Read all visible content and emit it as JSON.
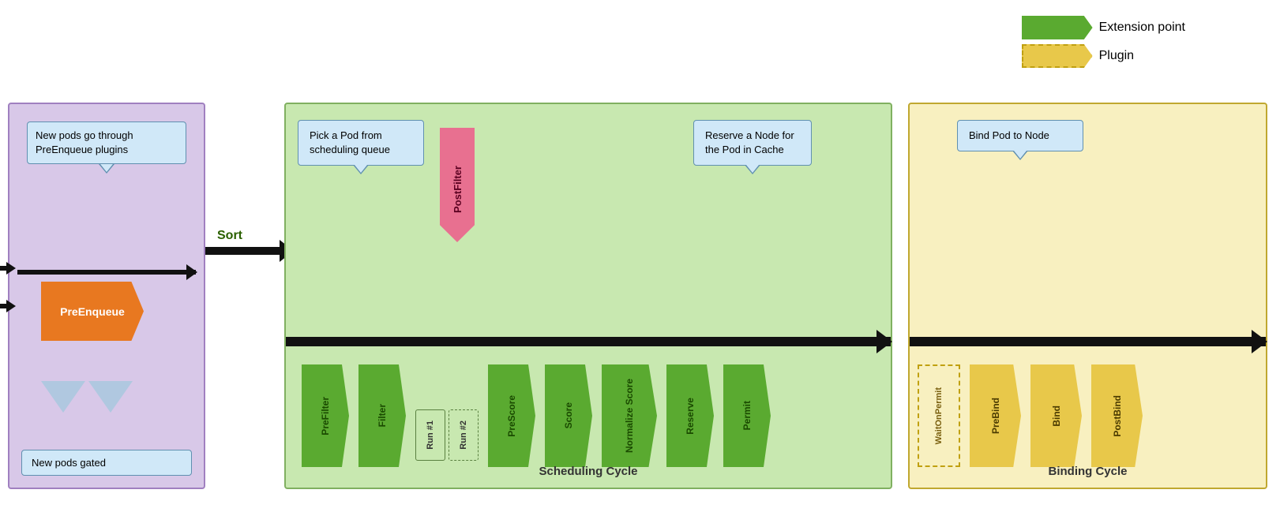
{
  "legend": {
    "extension_point_label": "Extension point",
    "plugin_label": "Plugin"
  },
  "left_panel": {
    "callout_text": "New pods go through PreEnqueue plugins",
    "preenqueue_label": "PreEnqueue",
    "new_pods_gated_label": "New pods gated"
  },
  "sort_label": "Sort",
  "scheduling_panel": {
    "pick_pod_callout": "Pick a Pod from scheduling queue",
    "reserve_callout": "Reserve a Node for the Pod in Cache",
    "postfilter_label": "PostFilter",
    "stages": [
      "PreFilter",
      "Filter",
      "PreScore",
      "Score",
      "Normalize Score",
      "Reserve",
      "Permit"
    ],
    "run1_label": "Run #1",
    "run2_label": "Run #2",
    "cycle_label": "Scheduling Cycle"
  },
  "binding_panel": {
    "bind_callout": "Bind Pod to Node",
    "waitonpermit_label": "WaitOnPermit",
    "stages": [
      "PreBind",
      "Bind",
      "PostBind"
    ],
    "cycle_label": "Binding Cycle"
  }
}
